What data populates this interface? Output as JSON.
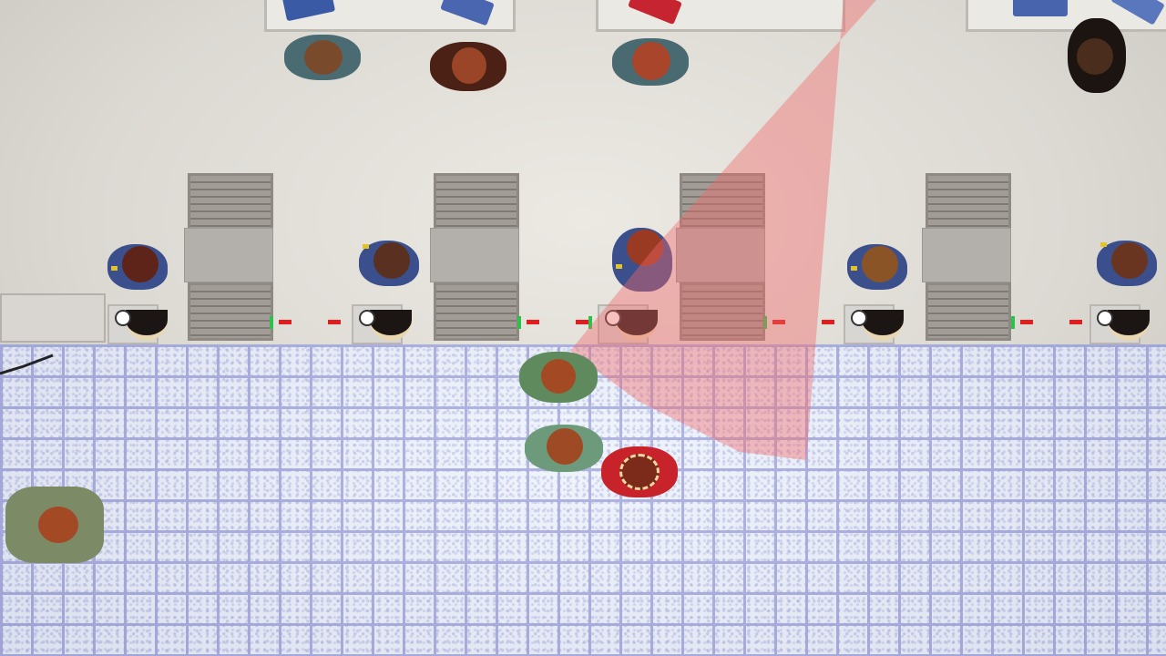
{
  "game": {
    "scene": "security-checkpoint",
    "colors": {
      "floor_tile": "#eef3fb",
      "grout": "#9fa3da",
      "wall": "#dcd9d3",
      "guard_uniform": "#3a4f8c",
      "laser": "#e11d1d",
      "laser_emitter": "#2fbf4a",
      "vision_cone": "#f06a6a",
      "player_jacket": "#c8232b"
    },
    "turnstiles": [
      "turnstile-1",
      "turnstile-2",
      "turnstile-3",
      "turnstile-4"
    ],
    "guards": [
      "guard-1",
      "guard-2",
      "guard-3",
      "guard-4",
      "guard-5"
    ],
    "laser_gates": 5,
    "icons": {
      "folder": "folder-icon",
      "badge": "badge-icon",
      "laser": "laser-beam-icon"
    }
  }
}
